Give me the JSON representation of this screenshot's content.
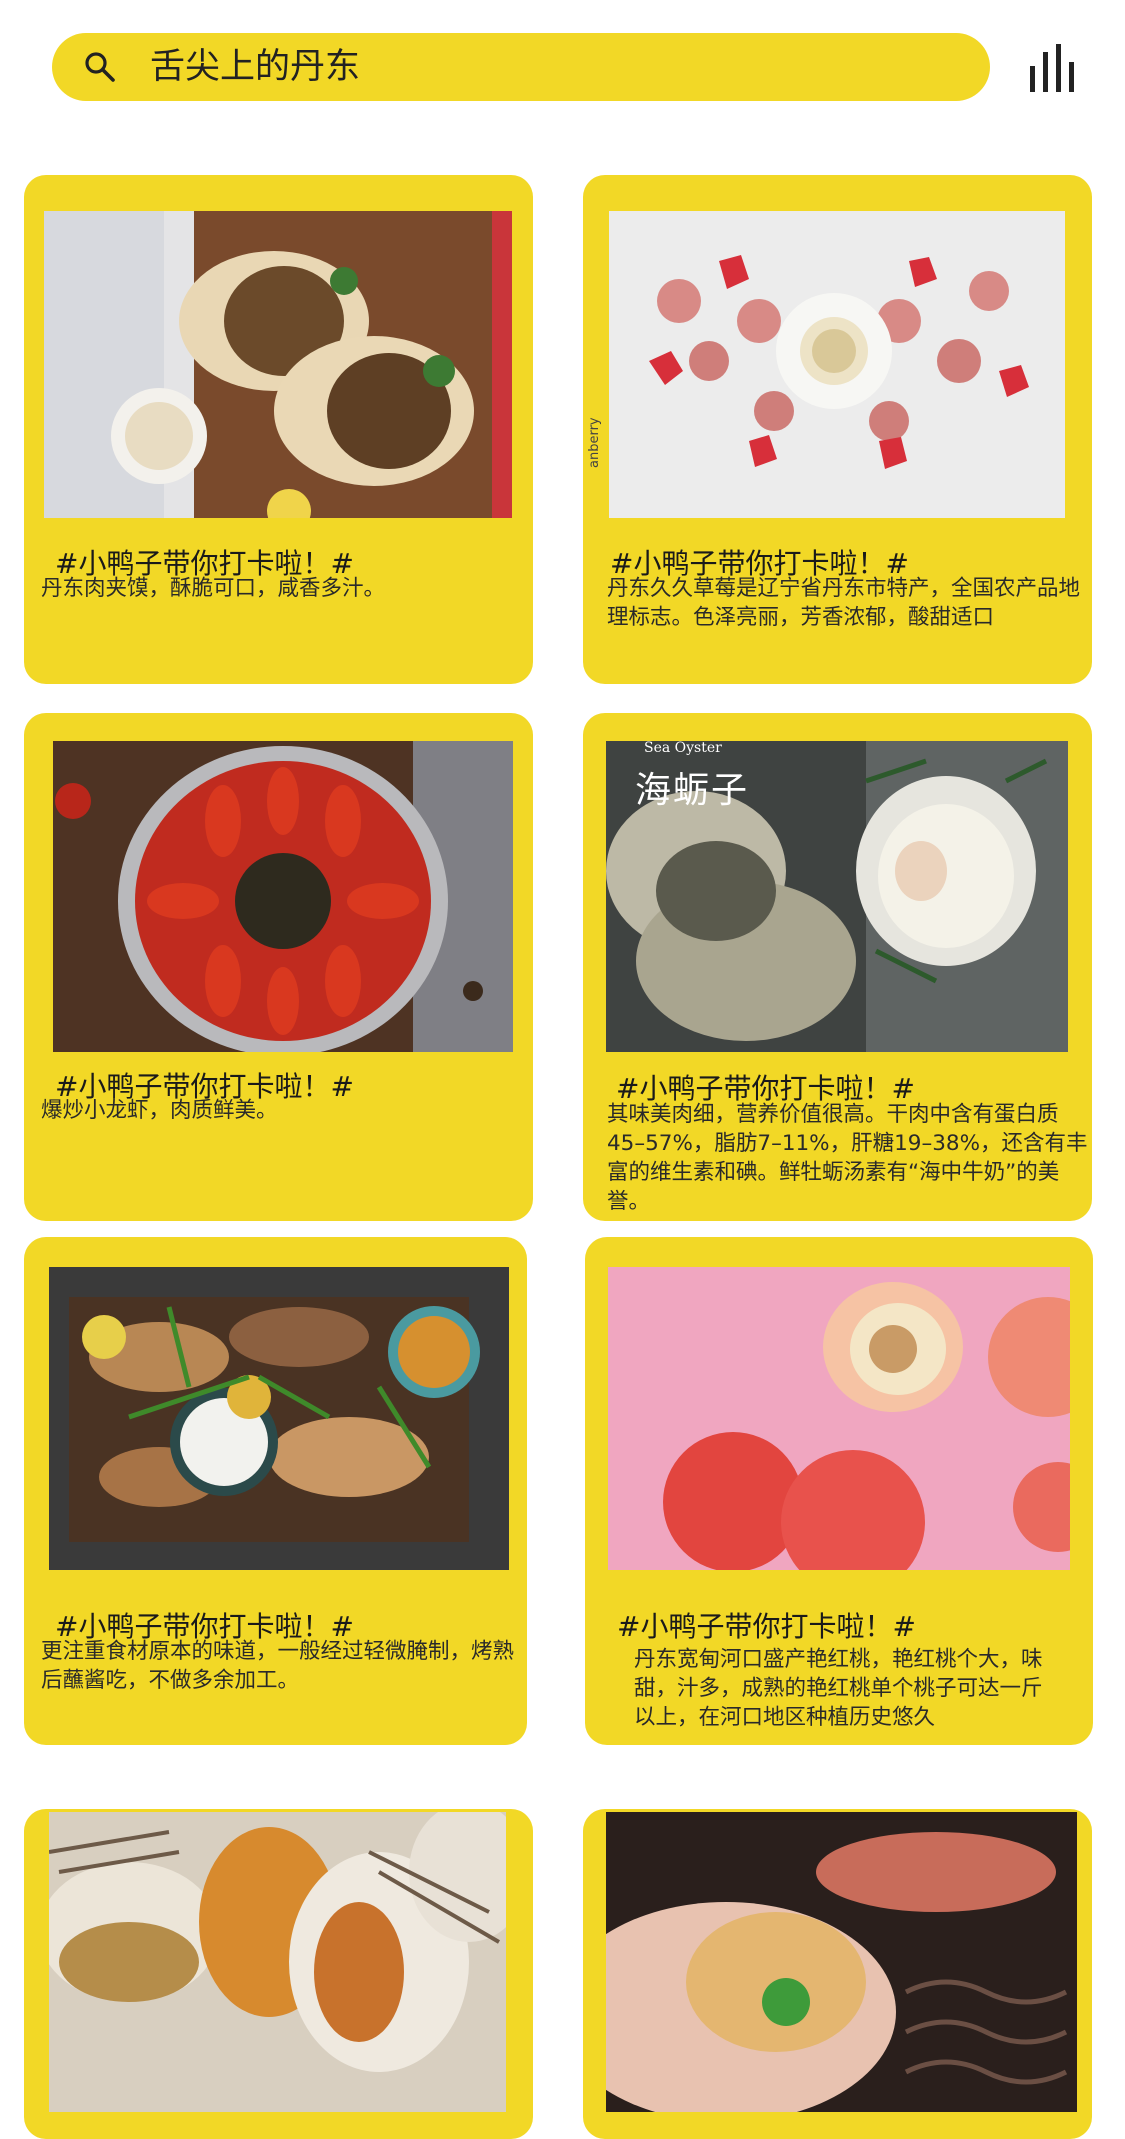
{
  "search": {
    "query": "舌尖上的丹东",
    "icon": "search-icon"
  },
  "menu": {
    "icon": "equalizer-icon"
  },
  "colors": {
    "accent": "#f2d826",
    "text": "#1a1a1a"
  },
  "cards": [
    {
      "image": "flatbread-sandwich-photo",
      "tag": "#小鸭子带你打卡啦！#",
      "desc": "丹东肉夹馍，酥脆可口，咸香多汁。"
    },
    {
      "image": "strawberry-sausage-photo",
      "image_caption": "anberry",
      "tag": "#小鸭子带你打卡啦！#",
      "desc": "丹东久久草莓是辽宁省丹东市特产，全国农产品地理标志。色泽亮丽，芳香浓郁，酸甜适口"
    },
    {
      "image": "crayfish-photo",
      "tag": "#小鸭子带你打卡啦！#",
      "desc": "爆炒小龙虾，肉质鲜美。"
    },
    {
      "image": "oyster-photo",
      "image_caption": "Sea Oyster",
      "image_title": "海蛎子",
      "tag": "#小鸭子带你打卡啦！#",
      "desc": "其味美肉细，营养价值很高。干肉中含有蛋白质45–57%，脂肪7–11%，肝糖19–38%，还含有丰富的维生素和碘。鲜牡蛎汤素有“海中牛奶”的美誉。"
    },
    {
      "image": "grilled-platter-photo",
      "tag": "#小鸭子带你打卡啦！#",
      "desc": "更注重食材原本的味道，一般经过轻微腌制，烤熟后蘸酱吃，不做多余加工。"
    },
    {
      "image": "peach-photo",
      "tag": "#小鸭子带你打卡啦！#",
      "desc": "丹东宽甸河口盛产艳红桃，艳红桃个大，味甜，汁多，成熟的艳红桃单个桃子可达一斤以上，在河口地区种植历史悠久"
    },
    {
      "image": "scallop-photo"
    },
    {
      "image": "grilled-seafood-photo"
    }
  ]
}
